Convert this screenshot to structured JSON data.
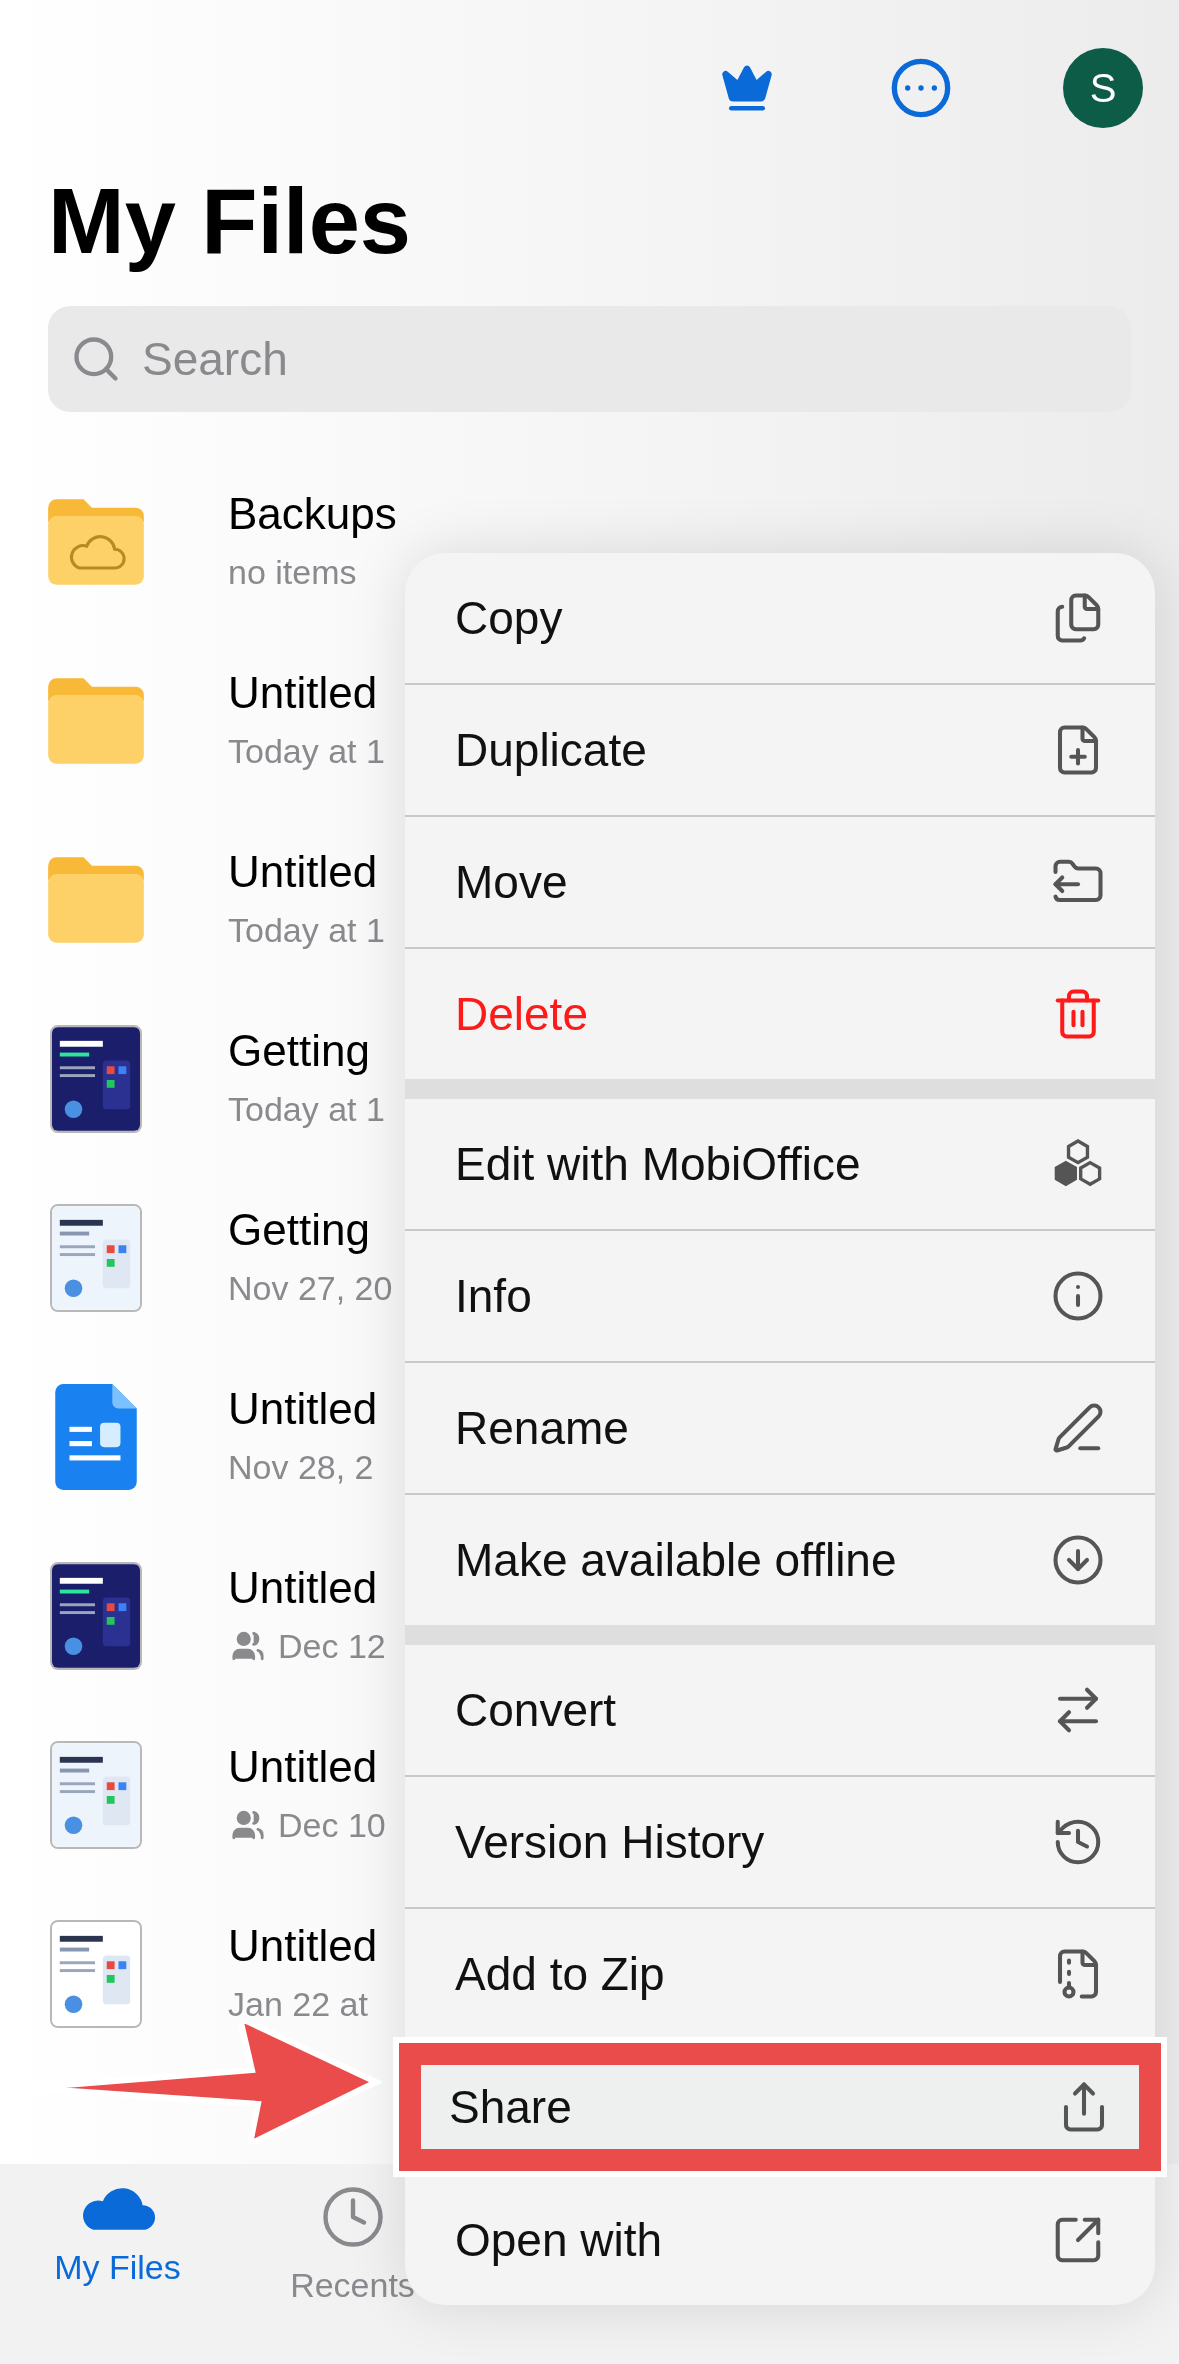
{
  "header": {
    "avatar": "S"
  },
  "title": "My Files",
  "search": {
    "placeholder": "Search"
  },
  "files": [
    {
      "kind": "cloud-folder",
      "name": "Backups",
      "detail": "no items",
      "shared": false
    },
    {
      "kind": "folder",
      "name": "Untitled",
      "detail": "Today at 1",
      "shared": false
    },
    {
      "kind": "folder",
      "name": "Untitled",
      "detail": "Today at 1",
      "shared": false
    },
    {
      "kind": "picture",
      "name": "Getting",
      "detail": "Today at 1",
      "shared": false
    },
    {
      "kind": "picture",
      "name": "Getting",
      "detail": "Nov 27, 20",
      "shared": false
    },
    {
      "kind": "document",
      "name": "Untitled",
      "detail": "Nov 28, 2",
      "shared": false
    },
    {
      "kind": "picture",
      "name": "Untitled",
      "detail": "Dec 12",
      "shared": true
    },
    {
      "kind": "picture",
      "name": "Untitled",
      "detail": "Dec 10",
      "shared": true
    },
    {
      "kind": "picture",
      "name": "Untitled",
      "detail": "Jan 22 at",
      "shared": false
    }
  ],
  "menu": {
    "groups": [
      [
        {
          "label": "Copy",
          "kind": "normal",
          "annotated": false
        },
        {
          "label": "Duplicate",
          "kind": "normal",
          "annotated": false
        },
        {
          "label": "Move",
          "kind": "normal",
          "annotated": false
        },
        {
          "label": "Delete",
          "kind": "destructive",
          "annotated": false
        }
      ],
      [
        {
          "label": "Edit with MobiOffice",
          "kind": "normal",
          "annotated": false
        },
        {
          "label": "Info",
          "kind": "normal",
          "annotated": false
        },
        {
          "label": "Rename",
          "kind": "normal",
          "annotated": false
        },
        {
          "label": "Make available offline",
          "kind": "normal",
          "annotated": false
        }
      ],
      [
        {
          "label": "Convert",
          "kind": "normal",
          "annotated": false
        },
        {
          "label": "Version History",
          "kind": "normal",
          "annotated": false
        },
        {
          "label": "Add to Zip",
          "kind": "normal",
          "annotated": false
        },
        {
          "label": "Share",
          "kind": "normal",
          "annotated": true
        },
        {
          "label": "Open with",
          "kind": "normal",
          "annotated": false
        }
      ]
    ]
  },
  "tabs": [
    {
      "label": "My Files",
      "selected": true
    },
    {
      "label": "Recents",
      "selected": false
    }
  ]
}
